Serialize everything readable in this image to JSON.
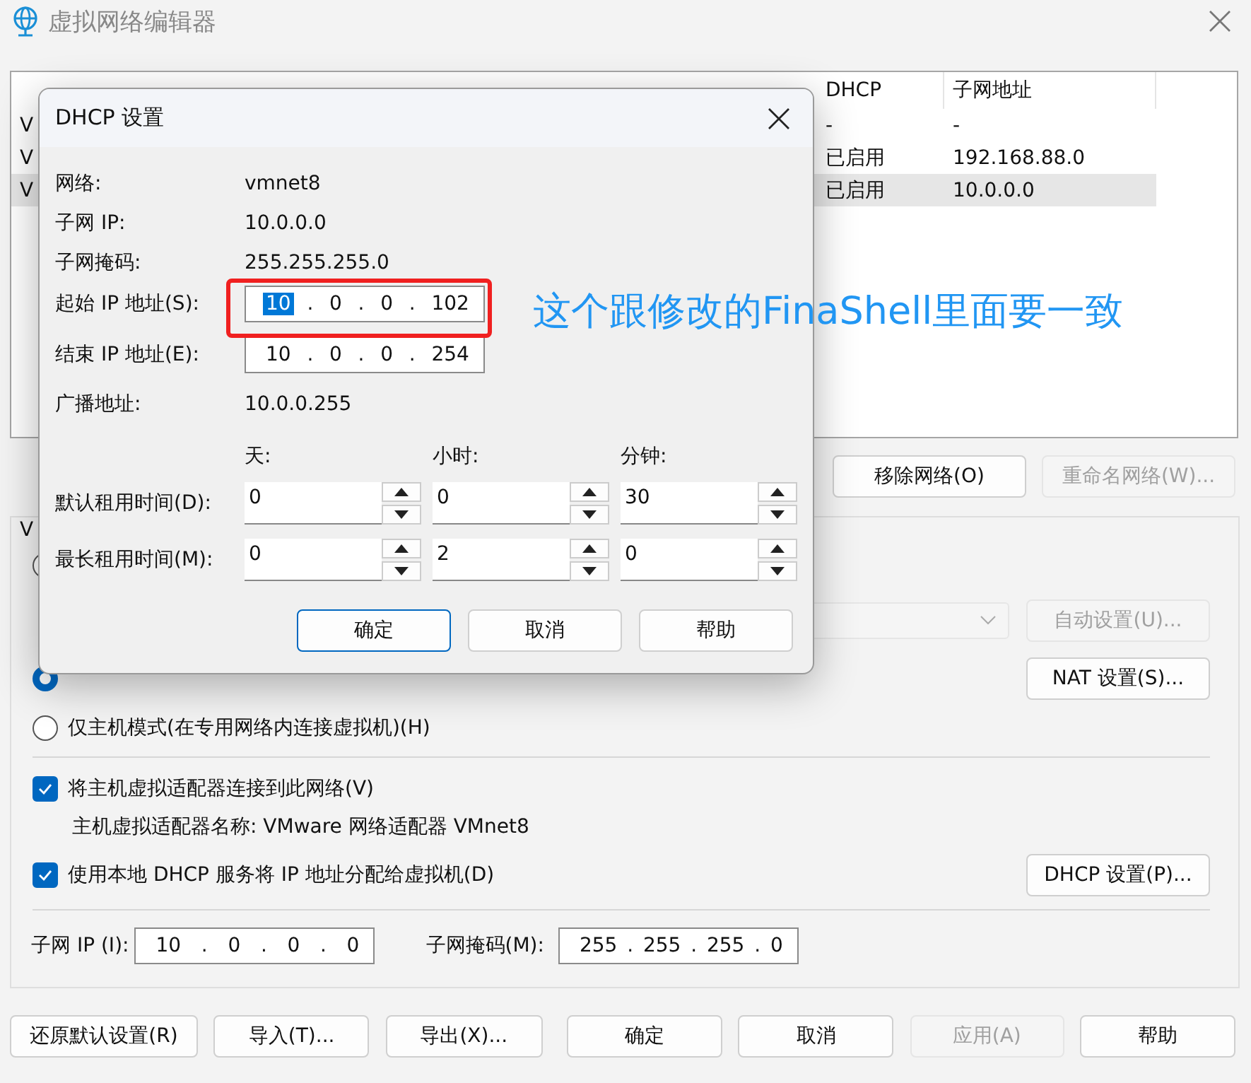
{
  "window": {
    "title": "虚拟网络编辑器"
  },
  "network_table": {
    "columns": [
      "DHCP",
      "子网地址"
    ],
    "rows": [
      {
        "name": "V",
        "dhcp": "-",
        "subnet": "-",
        "selected": false
      },
      {
        "name": "V",
        "dhcp": "已启用",
        "subnet": "192.168.88.0",
        "selected": false
      },
      {
        "name": "V",
        "dhcp": "已启用",
        "subnet": "10.0.0.0",
        "selected": true
      }
    ]
  },
  "table_buttons": [
    {
      "label": "移除网络(O)",
      "disabled": false
    },
    {
      "label": "重命名网络(W)...",
      "disabled": true
    }
  ],
  "network_info": {
    "group_label": "V",
    "bridged_radio": {
      "selected": false
    },
    "auto_button": {
      "label": "自动设置(U)...",
      "disabled": true
    },
    "nat_radio": {
      "selected": true
    },
    "nat_button": {
      "label": "NAT 设置(S)...",
      "disabled": false
    },
    "host_radio": {
      "label": "仅主机模式(在专用网络内连接虚拟机)(H)",
      "selected": false
    },
    "connect_adapter": {
      "label": "将主机虚拟适配器连接到此网络(V)",
      "checked": true
    },
    "adapter_name": "主机虚拟适配器名称: VMware 网络适配器 VMnet8",
    "use_dhcp": {
      "label": "使用本地 DHCP 服务将 IP 地址分配给虚拟机(D)",
      "checked": true
    },
    "dhcp_button": {
      "label": "DHCP 设置(P)...",
      "disabled": false
    },
    "subnet_ip": {
      "label": "子网 IP (I):",
      "separator": ".",
      "octets": [
        {
          "value": "10",
          "selected": false
        },
        {
          "value": "0",
          "selected": false
        },
        {
          "value": "0",
          "selected": false
        },
        {
          "value": "0",
          "selected": false
        }
      ]
    },
    "subnet_mask": {
      "label": "子网掩码(M):",
      "separator": ".",
      "octets": [
        {
          "value": "255",
          "selected": false
        },
        {
          "value": "255",
          "selected": false
        },
        {
          "value": "255",
          "selected": false
        },
        {
          "value": "0",
          "selected": false
        }
      ]
    }
  },
  "bottom_buttons": [
    {
      "label": "还原默认设置(R)",
      "disabled": false
    },
    {
      "label": "导入(T)...",
      "disabled": false
    },
    {
      "label": "导出(X)...",
      "disabled": false
    },
    {
      "label": "确定",
      "disabled": false
    },
    {
      "label": "取消",
      "disabled": false
    },
    {
      "label": "应用(A)",
      "disabled": true
    },
    {
      "label": "帮助",
      "disabled": false
    }
  ],
  "dhcp_dialog": {
    "title": "DHCP 设置",
    "info": [
      {
        "label": "网络:",
        "value": "vmnet8"
      },
      {
        "label": "子网 IP:",
        "value": "10.0.0.0"
      },
      {
        "label": "子网掩码:",
        "value": "255.255.255.0"
      }
    ],
    "start_ip": {
      "label": "起始 IP 地址(S):",
      "separator": ".",
      "octets": [
        {
          "value": "10",
          "selected": true
        },
        {
          "value": "0",
          "selected": false
        },
        {
          "value": "0",
          "selected": false
        },
        {
          "value": "102",
          "selected": false
        }
      ]
    },
    "end_ip": {
      "label": "结束 IP 地址(E):",
      "separator": ".",
      "octets": [
        {
          "value": "10",
          "selected": false
        },
        {
          "value": "0",
          "selected": false
        },
        {
          "value": "0",
          "selected": false
        },
        {
          "value": "254",
          "selected": false
        }
      ]
    },
    "broadcast": {
      "label": "广播地址:",
      "value": "10.0.0.255"
    },
    "lease_columns": [
      "天:",
      "小时:",
      "分钟:"
    ],
    "leases": [
      {
        "label": "默认租用时间(D):",
        "values": [
          "0",
          "0",
          "30"
        ]
      },
      {
        "label": "最长租用时间(M):",
        "values": [
          "0",
          "2",
          "0"
        ]
      }
    ],
    "buttons": [
      {
        "label": "确定",
        "default": true
      },
      {
        "label": "取消",
        "default": false
      },
      {
        "label": "帮助",
        "default": false
      }
    ]
  },
  "annotation": {
    "text": "这个跟修改的FinaShell里面要一致"
  }
}
